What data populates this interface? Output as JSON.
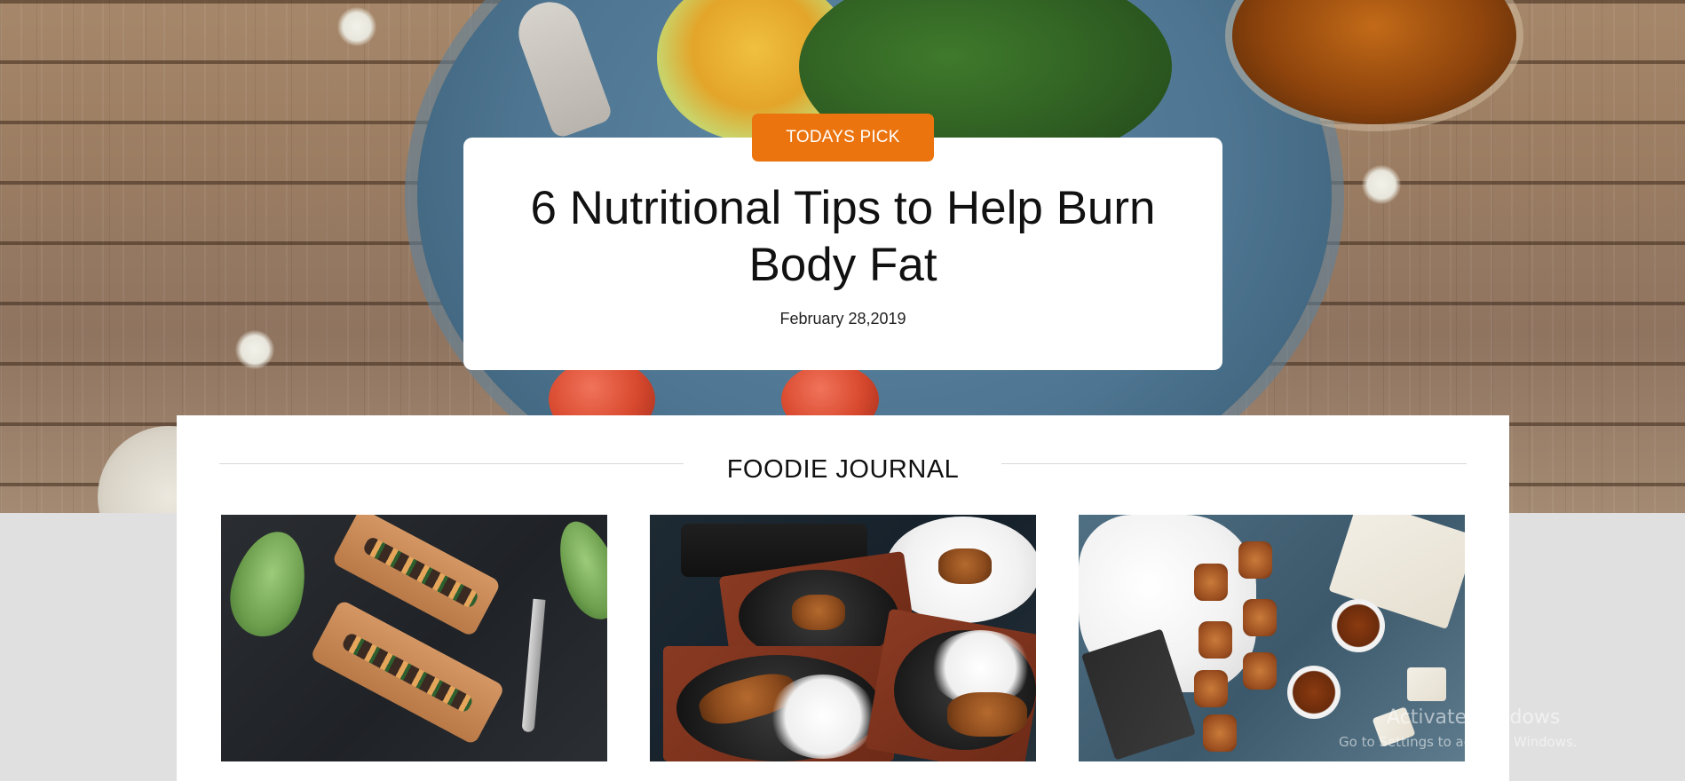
{
  "hero": {
    "badge": "TODAYS PICK",
    "title": "6 Nutritional Tips to Help Burn Body Fat",
    "date": "February 28,2019"
  },
  "journal": {
    "heading": "FOODIE JOURNAL",
    "posts": [
      {
        "image": "sushi-boards-photo"
      },
      {
        "image": "grilled-platters-photo"
      },
      {
        "image": "tea-and-toast-photo"
      }
    ]
  },
  "watermark": {
    "title": "Activate Windows",
    "subtitle": "Go to Settings to activate Windows."
  },
  "colors": {
    "accent": "#eb740f",
    "card": "#ffffff",
    "page_bg": "#e0e0e0",
    "divider": "#d9d9d9"
  }
}
